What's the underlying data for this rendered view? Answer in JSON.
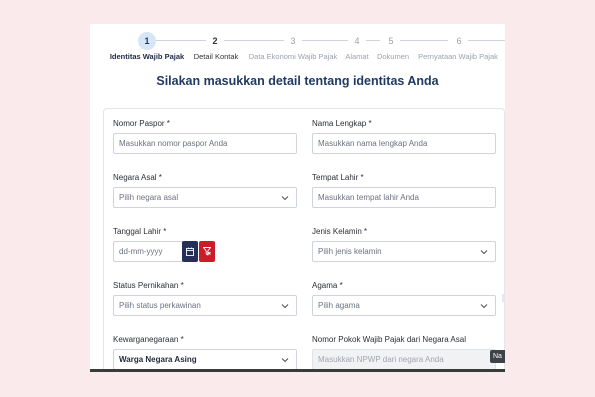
{
  "stepper": {
    "steps": [
      {
        "number": "1",
        "label": "Identitas Wajib Pajak"
      },
      {
        "number": "2",
        "label": "Detail Kontak"
      },
      {
        "number": "3",
        "label": "Data Ekonomi Wajib Pajak"
      },
      {
        "number": "4",
        "label": "Alamat"
      },
      {
        "number": "5",
        "label": "Dokumen"
      },
      {
        "number": "6",
        "label": "Pernyataan Wajib Pajak"
      }
    ]
  },
  "heading": "Silakan masukkan detail tentang identitas Anda",
  "form": {
    "passport": {
      "label": "Nomor Paspor *",
      "placeholder": "Masukkan nomor paspor Anda"
    },
    "full_name": {
      "label": "Nama Lengkap *",
      "placeholder": "Masukkan nama lengkap Anda"
    },
    "country": {
      "label": "Negara Asal *",
      "placeholder": "Pilih negara asal"
    },
    "birth_place": {
      "label": "Tempat Lahir *",
      "placeholder": "Masukkan tempat lahir Anda"
    },
    "birth_date": {
      "label": "Tanggal Lahir *",
      "placeholder": "dd-mm-yyyy"
    },
    "gender": {
      "label": "Jenis Kelamin *",
      "placeholder": "Pilih jenis kelamin"
    },
    "marital": {
      "label": "Status Pernikahan *",
      "placeholder": "Pilih status perkawinan"
    },
    "religion": {
      "label": "Agama *",
      "placeholder": "Pilih agama"
    },
    "citizenship": {
      "label": "Kewarganegaraan *",
      "value": "Warga Negara Asing"
    },
    "npwp": {
      "label": "Nomor Pokok Wajib Pajak dari Negara Asal",
      "placeholder": "Masukkan NPWP dari negara Anda"
    }
  },
  "side_tab": "Na"
}
